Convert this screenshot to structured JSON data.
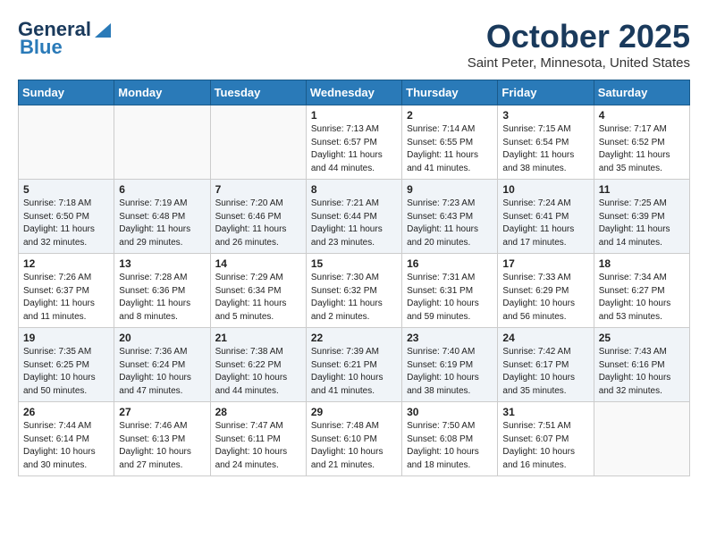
{
  "header": {
    "logo_line1": "General",
    "logo_line2": "Blue",
    "month": "October 2025",
    "location": "Saint Peter, Minnesota, United States"
  },
  "weekdays": [
    "Sunday",
    "Monday",
    "Tuesday",
    "Wednesday",
    "Thursday",
    "Friday",
    "Saturday"
  ],
  "weeks": [
    [
      {
        "day": "",
        "info": ""
      },
      {
        "day": "",
        "info": ""
      },
      {
        "day": "",
        "info": ""
      },
      {
        "day": "1",
        "info": "Sunrise: 7:13 AM\nSunset: 6:57 PM\nDaylight: 11 hours\nand 44 minutes."
      },
      {
        "day": "2",
        "info": "Sunrise: 7:14 AM\nSunset: 6:55 PM\nDaylight: 11 hours\nand 41 minutes."
      },
      {
        "day": "3",
        "info": "Sunrise: 7:15 AM\nSunset: 6:54 PM\nDaylight: 11 hours\nand 38 minutes."
      },
      {
        "day": "4",
        "info": "Sunrise: 7:17 AM\nSunset: 6:52 PM\nDaylight: 11 hours\nand 35 minutes."
      }
    ],
    [
      {
        "day": "5",
        "info": "Sunrise: 7:18 AM\nSunset: 6:50 PM\nDaylight: 11 hours\nand 32 minutes."
      },
      {
        "day": "6",
        "info": "Sunrise: 7:19 AM\nSunset: 6:48 PM\nDaylight: 11 hours\nand 29 minutes."
      },
      {
        "day": "7",
        "info": "Sunrise: 7:20 AM\nSunset: 6:46 PM\nDaylight: 11 hours\nand 26 minutes."
      },
      {
        "day": "8",
        "info": "Sunrise: 7:21 AM\nSunset: 6:44 PM\nDaylight: 11 hours\nand 23 minutes."
      },
      {
        "day": "9",
        "info": "Sunrise: 7:23 AM\nSunset: 6:43 PM\nDaylight: 11 hours\nand 20 minutes."
      },
      {
        "day": "10",
        "info": "Sunrise: 7:24 AM\nSunset: 6:41 PM\nDaylight: 11 hours\nand 17 minutes."
      },
      {
        "day": "11",
        "info": "Sunrise: 7:25 AM\nSunset: 6:39 PM\nDaylight: 11 hours\nand 14 minutes."
      }
    ],
    [
      {
        "day": "12",
        "info": "Sunrise: 7:26 AM\nSunset: 6:37 PM\nDaylight: 11 hours\nand 11 minutes."
      },
      {
        "day": "13",
        "info": "Sunrise: 7:28 AM\nSunset: 6:36 PM\nDaylight: 11 hours\nand 8 minutes."
      },
      {
        "day": "14",
        "info": "Sunrise: 7:29 AM\nSunset: 6:34 PM\nDaylight: 11 hours\nand 5 minutes."
      },
      {
        "day": "15",
        "info": "Sunrise: 7:30 AM\nSunset: 6:32 PM\nDaylight: 11 hours\nand 2 minutes."
      },
      {
        "day": "16",
        "info": "Sunrise: 7:31 AM\nSunset: 6:31 PM\nDaylight: 10 hours\nand 59 minutes."
      },
      {
        "day": "17",
        "info": "Sunrise: 7:33 AM\nSunset: 6:29 PM\nDaylight: 10 hours\nand 56 minutes."
      },
      {
        "day": "18",
        "info": "Sunrise: 7:34 AM\nSunset: 6:27 PM\nDaylight: 10 hours\nand 53 minutes."
      }
    ],
    [
      {
        "day": "19",
        "info": "Sunrise: 7:35 AM\nSunset: 6:25 PM\nDaylight: 10 hours\nand 50 minutes."
      },
      {
        "day": "20",
        "info": "Sunrise: 7:36 AM\nSunset: 6:24 PM\nDaylight: 10 hours\nand 47 minutes."
      },
      {
        "day": "21",
        "info": "Sunrise: 7:38 AM\nSunset: 6:22 PM\nDaylight: 10 hours\nand 44 minutes."
      },
      {
        "day": "22",
        "info": "Sunrise: 7:39 AM\nSunset: 6:21 PM\nDaylight: 10 hours\nand 41 minutes."
      },
      {
        "day": "23",
        "info": "Sunrise: 7:40 AM\nSunset: 6:19 PM\nDaylight: 10 hours\nand 38 minutes."
      },
      {
        "day": "24",
        "info": "Sunrise: 7:42 AM\nSunset: 6:17 PM\nDaylight: 10 hours\nand 35 minutes."
      },
      {
        "day": "25",
        "info": "Sunrise: 7:43 AM\nSunset: 6:16 PM\nDaylight: 10 hours\nand 32 minutes."
      }
    ],
    [
      {
        "day": "26",
        "info": "Sunrise: 7:44 AM\nSunset: 6:14 PM\nDaylight: 10 hours\nand 30 minutes."
      },
      {
        "day": "27",
        "info": "Sunrise: 7:46 AM\nSunset: 6:13 PM\nDaylight: 10 hours\nand 27 minutes."
      },
      {
        "day": "28",
        "info": "Sunrise: 7:47 AM\nSunset: 6:11 PM\nDaylight: 10 hours\nand 24 minutes."
      },
      {
        "day": "29",
        "info": "Sunrise: 7:48 AM\nSunset: 6:10 PM\nDaylight: 10 hours\nand 21 minutes."
      },
      {
        "day": "30",
        "info": "Sunrise: 7:50 AM\nSunset: 6:08 PM\nDaylight: 10 hours\nand 18 minutes."
      },
      {
        "day": "31",
        "info": "Sunrise: 7:51 AM\nSunset: 6:07 PM\nDaylight: 10 hours\nand 16 minutes."
      },
      {
        "day": "",
        "info": ""
      }
    ]
  ]
}
